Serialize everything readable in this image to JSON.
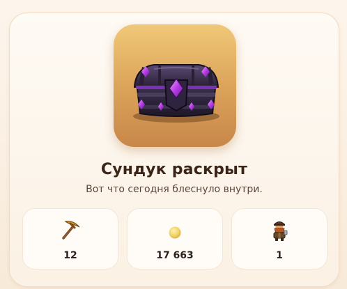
{
  "chest": {
    "icon": "treasure-chest-icon",
    "title": "Сундук раскрыт",
    "subtitle": "Вот что сегодня блеснуло внутри."
  },
  "rewards": [
    {
      "icon": "pickaxe-icon",
      "value": "12"
    },
    {
      "icon": "gold-coin-icon",
      "value": "17 663"
    },
    {
      "icon": "dwarf-miner-icon",
      "value": "1"
    }
  ],
  "colors": {
    "tile_top": "#f0c878",
    "tile_bottom": "#c8874a",
    "gem": "#b43ce6",
    "title": "#3b2418"
  }
}
